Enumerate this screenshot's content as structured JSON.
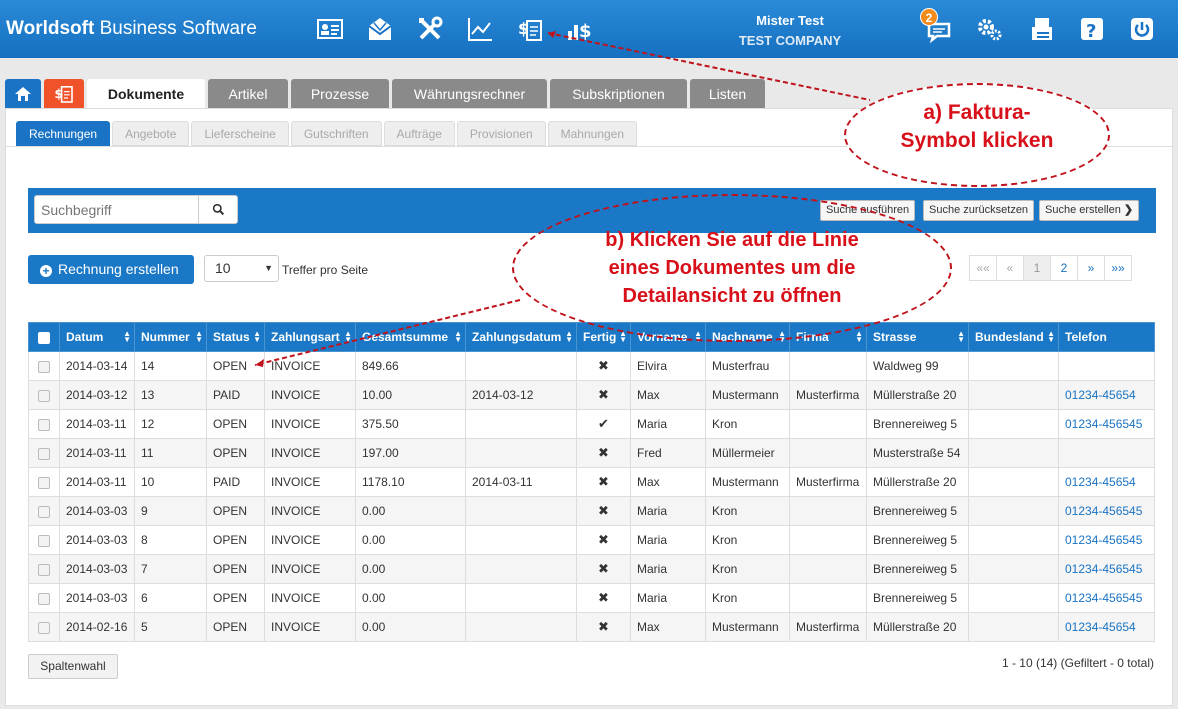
{
  "header": {
    "brand_bold": "Worldsoft",
    "brand_rest": " Business Software",
    "user_name": "Mister Test",
    "company": "TEST COMPANY",
    "notification_count": "2",
    "icons": [
      "contacts-card-icon",
      "mail-icon",
      "tools-icon",
      "chart-icon",
      "faktura-icon",
      "finance-icon",
      "chat-icon",
      "settings-icon",
      "fax-icon",
      "help-icon",
      "power-icon"
    ]
  },
  "main_tabs": [
    "Dokumente",
    "Artikel",
    "Prozesse",
    "Währungsrechner",
    "Subskriptionen",
    "Listen"
  ],
  "sub_tabs": [
    "Rechnungen",
    "Angebote",
    "Lieferscheine",
    "Gutschriften",
    "Aufträge",
    "Provisionen",
    "Mahnungen"
  ],
  "search": {
    "placeholder": "Suchbegriff",
    "execute": "Suche ausführen",
    "reset": "Suche zurücksetzen",
    "create": "Suche erstellen"
  },
  "controls": {
    "create_invoice": "Rechnung erstellen",
    "per_page_value": "10",
    "per_page_label": "Treffer pro Seite",
    "pagination": [
      "««",
      "«",
      "1",
      "2",
      "»",
      "»»"
    ]
  },
  "table": {
    "columns": [
      "Datum",
      "Nummer",
      "Status",
      "Zahlungsart",
      "Gesamtsumme",
      "Zahlungsdatum",
      "Fertig",
      "Vorname",
      "Nachname",
      "Firma",
      "Strasse",
      "Bundesland",
      "Telefon"
    ],
    "rows": [
      {
        "datum": "2014-03-14",
        "nummer": "14",
        "status": "OPEN",
        "zahlungsart": "INVOICE",
        "summe": "849.66",
        "zahlungsdatum": "",
        "fertig": "✖",
        "vorname": "Elvira",
        "nachname": "Musterfrau",
        "firma": "",
        "strasse": "Waldweg 99",
        "bundesland": "",
        "telefon": ""
      },
      {
        "datum": "2014-03-12",
        "nummer": "13",
        "status": "PAID",
        "zahlungsart": "INVOICE",
        "summe": "10.00",
        "zahlungsdatum": "2014-03-12",
        "fertig": "✖",
        "vorname": "Max",
        "nachname": "Mustermann",
        "firma": "Musterfirma",
        "strasse": "Müllerstraße 20",
        "bundesland": "",
        "telefon": "01234-45654"
      },
      {
        "datum": "2014-03-11",
        "nummer": "12",
        "status": "OPEN",
        "zahlungsart": "INVOICE",
        "summe": "375.50",
        "zahlungsdatum": "",
        "fertig": "✔",
        "vorname": "Maria",
        "nachname": "Kron",
        "firma": "",
        "strasse": "Brennereiweg 5",
        "bundesland": "",
        "telefon": "01234-456545"
      },
      {
        "datum": "2014-03-11",
        "nummer": "11",
        "status": "OPEN",
        "zahlungsart": "INVOICE",
        "summe": "197.00",
        "zahlungsdatum": "",
        "fertig": "✖",
        "vorname": "Fred",
        "nachname": "Müllermeier",
        "firma": "",
        "strasse": "Musterstraße 54",
        "bundesland": "",
        "telefon": ""
      },
      {
        "datum": "2014-03-11",
        "nummer": "10",
        "status": "PAID",
        "zahlungsart": "INVOICE",
        "summe": "1178.10",
        "zahlungsdatum": "2014-03-11",
        "fertig": "✖",
        "vorname": "Max",
        "nachname": "Mustermann",
        "firma": "Musterfirma",
        "strasse": "Müllerstraße 20",
        "bundesland": "",
        "telefon": "01234-45654"
      },
      {
        "datum": "2014-03-03",
        "nummer": "9",
        "status": "OPEN",
        "zahlungsart": "INVOICE",
        "summe": "0.00",
        "zahlungsdatum": "",
        "fertig": "✖",
        "vorname": "Maria",
        "nachname": "Kron",
        "firma": "",
        "strasse": "Brennereiweg 5",
        "bundesland": "",
        "telefon": "01234-456545"
      },
      {
        "datum": "2014-03-03",
        "nummer": "8",
        "status": "OPEN",
        "zahlungsart": "INVOICE",
        "summe": "0.00",
        "zahlungsdatum": "",
        "fertig": "✖",
        "vorname": "Maria",
        "nachname": "Kron",
        "firma": "",
        "strasse": "Brennereiweg 5",
        "bundesland": "",
        "telefon": "01234-456545"
      },
      {
        "datum": "2014-03-03",
        "nummer": "7",
        "status": "OPEN",
        "zahlungsart": "INVOICE",
        "summe": "0.00",
        "zahlungsdatum": "",
        "fertig": "✖",
        "vorname": "Maria",
        "nachname": "Kron",
        "firma": "",
        "strasse": "Brennereiweg 5",
        "bundesland": "",
        "telefon": "01234-456545"
      },
      {
        "datum": "2014-03-03",
        "nummer": "6",
        "status": "OPEN",
        "zahlungsart": "INVOICE",
        "summe": "0.00",
        "zahlungsdatum": "",
        "fertig": "✖",
        "vorname": "Maria",
        "nachname": "Kron",
        "firma": "",
        "strasse": "Brennereiweg 5",
        "bundesland": "",
        "telefon": "01234-456545"
      },
      {
        "datum": "2014-02-16",
        "nummer": "5",
        "status": "OPEN",
        "zahlungsart": "INVOICE",
        "summe": "0.00",
        "zahlungsdatum": "",
        "fertig": "✖",
        "vorname": "Max",
        "nachname": "Mustermann",
        "firma": "Musterfirma",
        "strasse": "Müllerstraße 20",
        "bundesland": "",
        "telefon": "01234-45654"
      }
    ]
  },
  "footer": {
    "column_select": "Spaltenwahl",
    "summary": "1 - 10 (14) (Gefiltert - 0 total)"
  },
  "annotations": {
    "a_line1": "a) Faktura-",
    "a_line2": "Symbol klicken",
    "b_line1": "b) Klicken Sie auf die Linie",
    "b_line2": "eines Dokumentes um die",
    "b_line3": "Detailansicht zu öffnen",
    "color": "#d8101a"
  },
  "colors": {
    "brand_blue": "#1a78c6",
    "faktura_orange": "#f0522a",
    "badge_orange": "#f28a1c"
  }
}
